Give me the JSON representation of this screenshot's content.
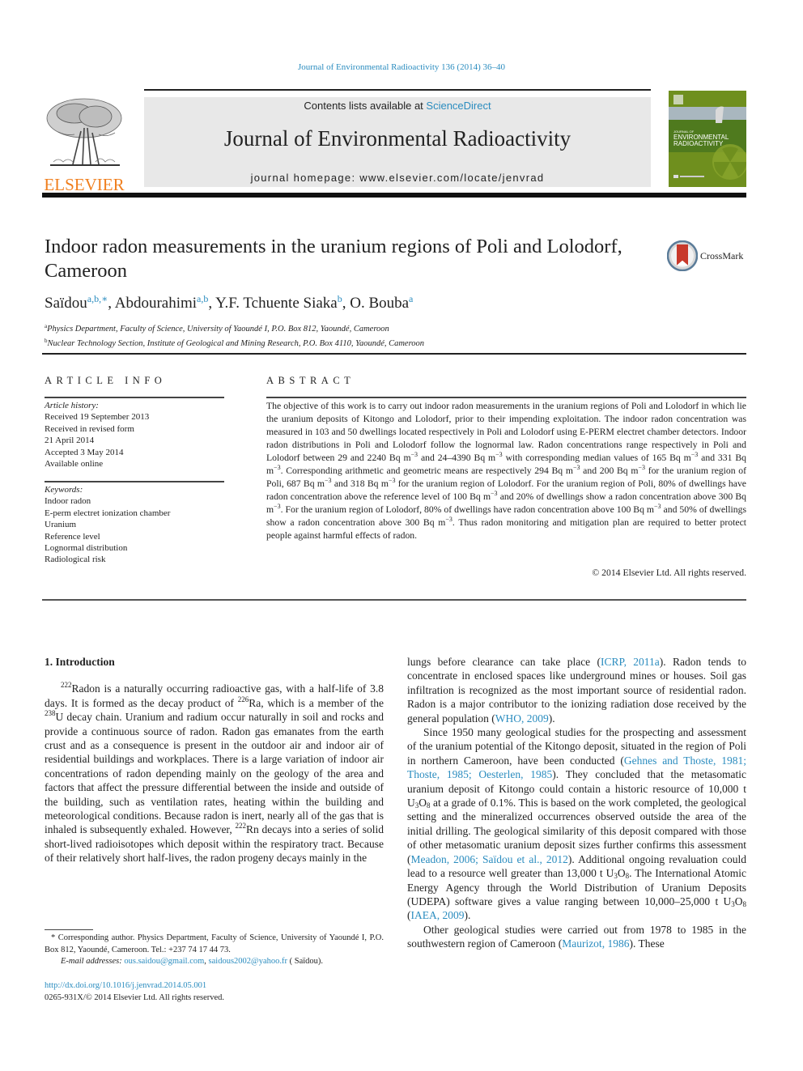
{
  "running_head": "Journal of Environmental Radioactivity 136 (2014) 36–40",
  "masthead": {
    "contents_prefix": "Contents lists available at ",
    "contents_link": "ScienceDirect",
    "journal_name": "Journal of Environmental Radioactivity",
    "homepage": "journal homepage: www.elsevier.com/locate/jenvrad",
    "publisher_logo_text": "ELSEVIER",
    "cover_title_small": "JOURNAL OF",
    "cover_title_line1": "ENVIRONMENTAL",
    "cover_title_line2": "RADIOACTIVITY"
  },
  "colors": {
    "link": "#2a8cbf",
    "elsevier_orange": "#f07f1e",
    "cover_green": "#6d8f1c",
    "banner_gray": "#e8e8e8"
  },
  "article": {
    "title": "Indoor radon measurements in the uranium regions of Poli and Lolodorf, Cameroon",
    "crossmark_label": "CrossMark",
    "authors": [
      {
        "name": "Saïdou",
        "aff": "a,b,∗"
      },
      {
        "name": "Abdourahimi",
        "aff": "a,b"
      },
      {
        "name": "Y.F. Tchuente Siaka",
        "aff": "b"
      },
      {
        "name": "O. Bouba",
        "aff": "a"
      }
    ],
    "affiliations": [
      {
        "key": "a",
        "text": "Physics Department, Faculty of Science, University of Yaoundé I, P.O. Box 812, Yaoundé, Cameroon"
      },
      {
        "key": "b",
        "text": "Nuclear Technology Section, Institute of Geological and Mining Research, P.O. Box 4110, Yaoundé, Cameroon"
      }
    ]
  },
  "article_info": {
    "heading": "ARTICLE INFO",
    "history_label": "Article history:",
    "history": [
      "Received 19 September 2013",
      "Received in revised form",
      "21 April 2014",
      "Accepted 3 May 2014",
      "Available online"
    ],
    "keywords_label": "Keywords:",
    "keywords": [
      "Indoor radon",
      "E-perm electret ionization chamber",
      "Uranium",
      "Reference level",
      "Lognormal distribution",
      "Radiological risk"
    ]
  },
  "abstract": {
    "heading": "ABSTRACT",
    "segments": [
      "The objective of this work is to carry out indoor radon measurements in the uranium regions of Poli and Lolodorf in which lie the uranium deposits of Kitongo and Lolodorf, prior to their impending exploitation. The indoor radon concentration was measured in 103 and 50 dwellings located respectively in Poli and Lolodorf using E-PERM electret chamber detectors. Indoor radon distributions in Poli and Lolodorf follow the lognormal law. Radon concentrations range respectively in Poli and Lolodorf between 29 and 2240 Bq m",
      " and 24–4390 Bq m",
      " with corresponding median values of 165 Bq m",
      " and 331 Bq m",
      ". Corresponding arithmetic and geometric means are respectively 294 Bq m",
      " and 200 Bq m",
      " for the uranium region of Poli, 687 Bq m",
      " and 318 Bq m",
      " for the uranium region of Lolodorf. For the uranium region of Poli, 80% of dwellings have radon concentration above the reference level of 100 Bq m",
      " and 20% of dwellings show a radon concentration above 300 Bq m",
      ". For the uranium region of Lolodorf, 80% of dwellings have radon concentration above 100 Bq m",
      " and 50% of dwellings show a radon concentration above 300 Bq m",
      ". Thus radon monitoring and mitigation plan are required to better protect people against harmful effects of radon."
    ],
    "exponent": "−3",
    "copyright": "© 2014 Elsevier Ltd. All rights reserved."
  },
  "body": {
    "section_heading": "1.  Introduction",
    "left_para": {
      "sup_222": "222",
      "t1": "Radon is a naturally occurring radioactive gas, with a half-life of 3.8 days. It is formed as the decay product of ",
      "sup_226": "226",
      "t2": "Ra, which is a member of the ",
      "sup_238": "238",
      "t3": "U decay chain. Uranium and radium occur naturally in soil and rocks and provide a continuous source of radon. Radon gas emanates from the earth crust and as a consequence is present in the outdoor air and indoor air of residential buildings and workplaces. There is a large variation of indoor air concentrations of radon depending mainly on the geology of the area and factors that affect the pressure differential between the inside and outside of the building, such as ventilation rates, heating within the building and meteorological conditions. Because radon is inert, nearly all of the gas that is inhaled is subsequently exhaled. However, ",
      "sup_222b": "222",
      "t4": "Rn decays into a series of solid short-lived radioisotopes which deposit within the respiratory tract. Because of their relatively short half-lives, the radon progeny decays mainly in the"
    },
    "right_p1": {
      "t1": "lungs before clearance can take place (",
      "ref1": "ICRP, 2011a",
      "t2": "). Radon tends to concentrate in enclosed spaces like underground mines or houses. Soil gas infiltration is recognized as the most important source of residential radon. Radon is a major contributor to the ionizing radiation dose received by the general population (",
      "ref2": "WHO, 2009",
      "t3": ")."
    },
    "right_p2": {
      "t1": "Since 1950 many geological studies for the prospecting and assessment of the uranium potential of the Kitongo deposit, situated in the region of Poli in northern Cameroon, have been conducted (",
      "ref1": "Gehnes and Thoste, 1981; Thoste, 1985; Oesterlen, 1985",
      "t2": "). They concluded that the metasomatic uranium deposit of Kitongo could contain a historic resource of 10,000 t U",
      "t3": "O",
      "t4": " at a grade of 0.1%. This is based on the work completed, the geological setting and the mineralized occurrences observed outside the area of the initial drilling. The geological similarity of this deposit compared with those of other metasomatic uranium deposit sizes further confirms this assessment (",
      "ref2": "Meadon, 2006; Saïdou et al., 2012",
      "t5": "). Additional ongoing revaluation could lead to a resource well greater than 13,000 t U",
      "t6": "O",
      "t7": ". The International Atomic Energy Agency through the World Distribution of Uranium Deposits (UDEPA) software gives a value ranging between 10,000–25,000 t U",
      "t8": "O",
      "t9": " (",
      "ref3": "IAEA, 2009",
      "t10": ")."
    },
    "right_p3": {
      "t1": "Other geological studies were carried out from 1978 to 1985 in the southwestern region of Cameroon (",
      "ref1": "Maurizot, 1986",
      "t2": "). These"
    },
    "sub3": "3",
    "sub8": "8"
  },
  "footnote": {
    "corresponding": "* Corresponding author. Physics Department, Faculty of Science, University of Yaoundé I, P.O. Box 812, Yaoundé, Cameroon. Tel.: +237 74 17 44 73.",
    "email_label": "E-mail addresses: ",
    "email1": "ous.saidou@gmail.com",
    "email_sep": ", ",
    "email2": "saidous2002@yahoo.fr",
    "email_suffix": " ( Saïdou).",
    "doi": "http://dx.doi.org/10.1016/j.jenvrad.2014.05.001",
    "issn": "0265-931X/© 2014 Elsevier Ltd. All rights reserved."
  }
}
